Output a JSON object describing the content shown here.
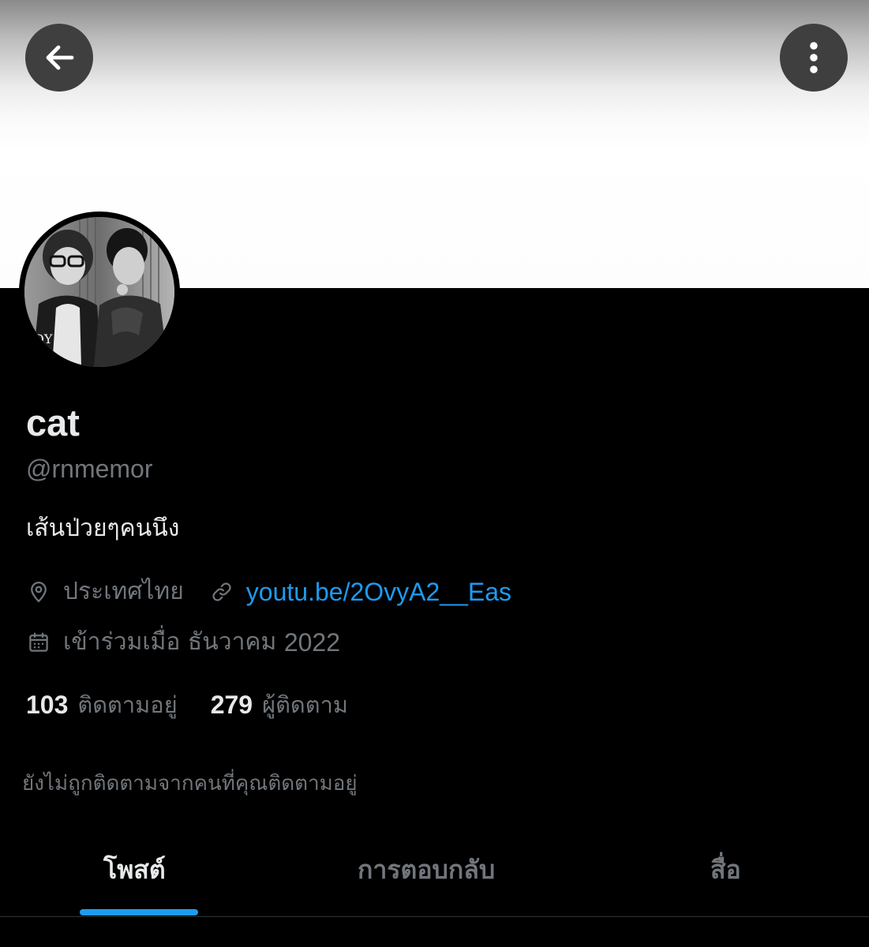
{
  "header": {
    "back_icon": "arrow-left-icon",
    "more_icon": "more-vertical-icon"
  },
  "profile": {
    "display_name": "cat",
    "handle": "@rnmemor",
    "bio": "เส้นป่วยๆคนนึง",
    "location": "ประเทศไทย",
    "website": "youtu.be/2OvyA2__Eas",
    "joined_prefix": "เข้าร่วมเมื่อ ธันวาคม",
    "joined_year": "2022"
  },
  "stats": {
    "following_count": "103",
    "following_label": "ติดตามอยู่",
    "followers_count": "279",
    "followers_label": "ผู้ติดตาม"
  },
  "notice": "ยังไม่ถูกติดตามจากคนที่คุณติดตามอยู่",
  "tabs": [
    {
      "label": "โพสต์",
      "active": true
    },
    {
      "label": "การตอบกลับ",
      "active": false
    },
    {
      "label": "สื่อ",
      "active": false
    }
  ],
  "colors": {
    "background": "#000000",
    "primary_text": "#e7e9ea",
    "secondary_text": "#71767b",
    "link": "#1d9bf0",
    "button_bg": "#3f3f3f"
  }
}
